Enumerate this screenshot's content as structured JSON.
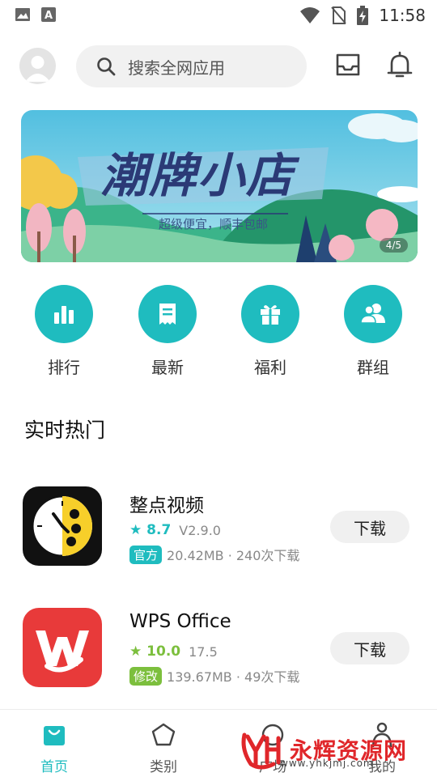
{
  "status_bar": {
    "time": "11:58",
    "icons": [
      "image-icon",
      "a-font-icon",
      "wifi-icon",
      "no-sim-icon",
      "battery-charging-icon"
    ]
  },
  "header": {
    "search_placeholder": "搜索全网应用",
    "icons": [
      "avatar-icon",
      "search-icon",
      "inbox-icon",
      "bell-icon"
    ]
  },
  "banner": {
    "title": "潮牌小店",
    "subtitle": "超级便宜，顺丰包邮",
    "page_indicator": "4/5"
  },
  "quick_nav": [
    {
      "label": "排行",
      "icon": "bar-chart-icon"
    },
    {
      "label": "最新",
      "icon": "receipt-icon"
    },
    {
      "label": "福利",
      "icon": "gift-icon"
    },
    {
      "label": "群组",
      "icon": "group-icon"
    }
  ],
  "section": {
    "title": "实时热门"
  },
  "apps": [
    {
      "name": "整点视频",
      "rating": "8.7",
      "version": "V2.9.0",
      "tag": "官方",
      "tag_color": "#1fbcbf",
      "size_info": "20.42MB · 240次下载",
      "button": "下载",
      "icon": "zhengdian-video-icon"
    },
    {
      "name": "WPS Office",
      "rating": "10.0",
      "version": "17.5",
      "tag": "修改",
      "tag_color": "#7cbf3d",
      "size_info": "139.67MB · 49次下载",
      "button": "下载",
      "icon": "wps-office-icon"
    }
  ],
  "bottom_nav": [
    {
      "label": "首页",
      "icon": "shopping-bag-icon",
      "active": true
    },
    {
      "label": "类别",
      "icon": "pentagon-icon",
      "active": false
    },
    {
      "label": "广场",
      "icon": "square-icon",
      "active": false
    },
    {
      "label": "我的",
      "icon": "person-icon",
      "active": false
    }
  ],
  "watermark": {
    "text": "永辉资源网",
    "url": "www.yhkjmj.com"
  },
  "colors": {
    "accent": "#1fbcbf",
    "green": "#7cbf3d",
    "wps_red": "#e83a3a"
  }
}
